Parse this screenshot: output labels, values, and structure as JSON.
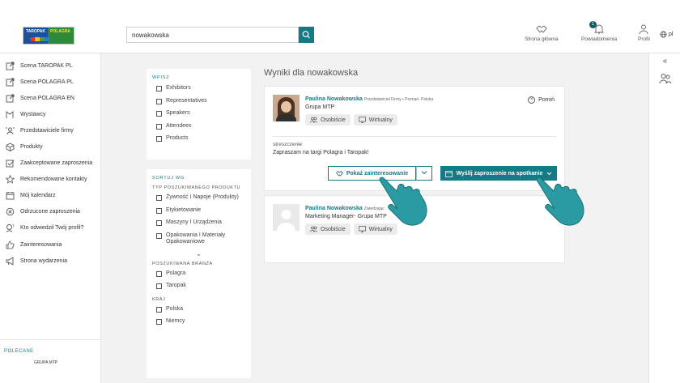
{
  "brand": {
    "logo_text_left": "TAROPAK",
    "logo_text_right": "POLAGRA"
  },
  "search": {
    "value": "nowakowska"
  },
  "topnav": {
    "home": "Strona główna",
    "notifications": "Powiadomienia",
    "notifications_count": "1",
    "profile": "Profil",
    "language": "pl"
  },
  "sidebar": {
    "items": [
      {
        "label": "Scena TAROPAK PL",
        "icon": "external-link-icon"
      },
      {
        "label": "Scena POLAGRA PL",
        "icon": "external-link-icon"
      },
      {
        "label": "Scena POLAGRA EN",
        "icon": "external-link-icon"
      },
      {
        "label": "Wystawcy",
        "icon": "exhibitors-icon"
      },
      {
        "label": "Przedstawiciele firmy",
        "icon": "representatives-icon"
      },
      {
        "label": "Produkty",
        "icon": "box-icon"
      },
      {
        "label": "Zaakceptowane zaproszenia",
        "icon": "accepted-invite-icon"
      },
      {
        "label": "Rekomendowane kontakty",
        "icon": "star-icon"
      },
      {
        "label": "Mój kalendarz",
        "icon": "calendar-icon"
      },
      {
        "label": "Odrzucone zaproszenia",
        "icon": "rejected-icon"
      },
      {
        "label": "Kto odwiedził Twój profil?",
        "icon": "question-icon"
      },
      {
        "label": "Zainteresowania",
        "icon": "thumbs-up-icon"
      },
      {
        "label": "Strona wydarzenia",
        "icon": "megaphone-icon"
      }
    ],
    "recommended_label": "POLECANE",
    "recommended_company": "GRUPA MTP"
  },
  "filters": {
    "type_title": "WPISZ",
    "types": [
      "Exhibitors",
      "Representatives",
      "Speakers",
      "Attendees",
      "Products"
    ],
    "sort_title": "SORTUJ WG",
    "product_type_title": "TYP POSZUKIWANEGO PRODUKTU",
    "product_types": [
      "Żywność I Napoje (Produkty)",
      "Etykietowanie",
      "Maszyny I Urządzenia",
      "Opakowania I Materiały Opakowaniowe"
    ],
    "industry_title": "POSZUKIWANA BRANŻA",
    "industries": [
      "Polagra",
      "Taropak"
    ],
    "country_title": "KRAJ",
    "countries": [
      "Polska",
      "Niemcy"
    ]
  },
  "results": {
    "title": "Wyniki dla nowakowska",
    "cards": [
      {
        "name": "Paulina Nowakowska",
        "role": "Przedstawiciel Firmy • Poznań- Polska",
        "company": "Grupa MTP",
        "tags": [
          "Osobiście",
          "Wirtualny"
        ],
        "skip_label": "Pomiń",
        "summary_label": "streszczenie",
        "summary": "Zapraszam na targi Polagra i Taropak!",
        "interest_button": "Pokaż zainteresowanie",
        "invite_button": "Wyślij zaproszenie na spotkanie"
      },
      {
        "name": "Paulina Nowakowska",
        "role": "Zwiedzając",
        "company": "Marketing Manager- Grupa MTP",
        "tags": [
          "Osobiście",
          "Wirtualny"
        ]
      }
    ]
  },
  "colors": {
    "accent": "#147a86",
    "hand": "#2a9aa3"
  }
}
